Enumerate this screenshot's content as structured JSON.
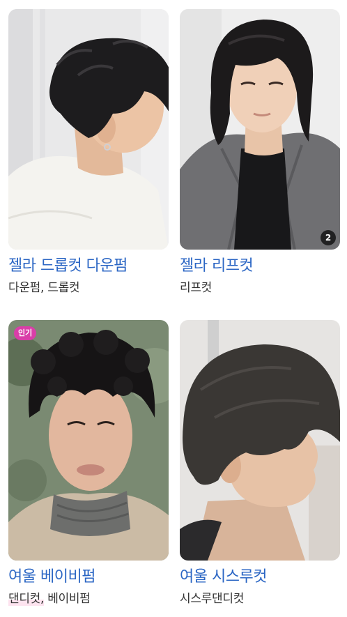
{
  "cards": [
    {
      "title": "젤라 드롭컷 다운펌",
      "tags": "다운펌, 드롭컷",
      "image_alt": "side profile of man with short textured dark hair, white t-shirt"
    },
    {
      "title": "젤라 리프컷",
      "tags": "리프컷",
      "image_count": "2",
      "image_alt": "man with medium length wavy dark hair, grey jacket"
    },
    {
      "title": "여울 베이비펌",
      "tags_highlight": "댄디컷,",
      "tags_rest": " 베이비펌",
      "badge": "인기",
      "image_alt": "front portrait of man with curly dark baby perm"
    },
    {
      "title": "여울 시스루컷",
      "tags": "시스루댄디컷",
      "image_alt": "side view of man with see-through bangs haircut"
    }
  ],
  "colors": {
    "title": "#2b66c4",
    "tags": "#333333",
    "popular_badge": "#d93ea8",
    "count_badge": "#1a1a1a"
  }
}
